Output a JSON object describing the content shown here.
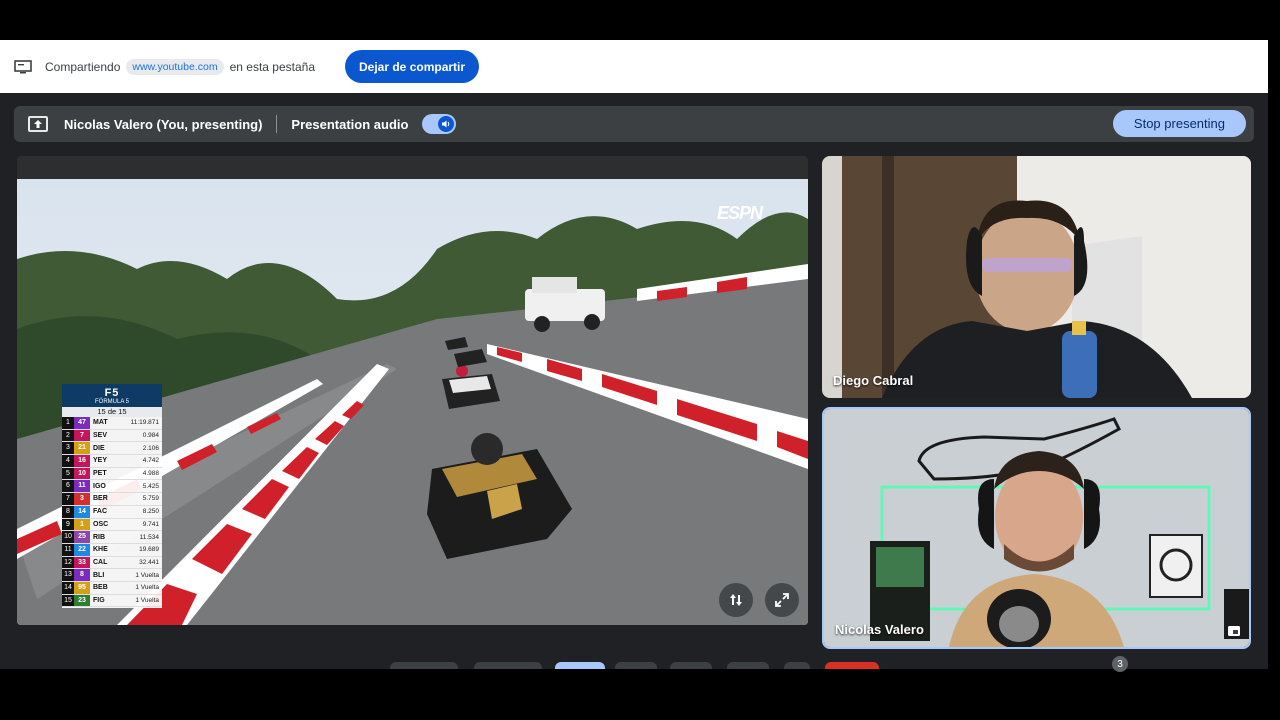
{
  "share_bar": {
    "prefix": "Compartiendo",
    "site": "www.youtube.com",
    "suffix": "en esta pestaña",
    "stop_label": "Dejar de compartir"
  },
  "presenting_bar": {
    "presenter": "Nicolas Valero (You, presenting)",
    "audio_label": "Presentation audio",
    "audio_on": true,
    "stop_label": "Stop presenting"
  },
  "video": {
    "broadcaster": "ESPN",
    "timing_tower": {
      "series": "FÓRMULA 5",
      "lap": "15 de 15",
      "rows": [
        {
          "pos": "1",
          "num": "47",
          "code": "MAT",
          "time": "11:19.871",
          "color": "#7b2cbf"
        },
        {
          "pos": "2",
          "num": "7",
          "code": "SEV",
          "time": "0.984",
          "color": "#c2185b"
        },
        {
          "pos": "3",
          "num": "21",
          "code": "DIE",
          "time": "2.106",
          "color": "#d4a017"
        },
        {
          "pos": "4",
          "num": "16",
          "code": "YEY",
          "time": "4.742",
          "color": "#c2185b"
        },
        {
          "pos": "5",
          "num": "10",
          "code": "PET",
          "time": "4.988",
          "color": "#c2185b"
        },
        {
          "pos": "6",
          "num": "11",
          "code": "IGO",
          "time": "5.425",
          "color": "#7b2cbf"
        },
        {
          "pos": "7",
          "num": "3",
          "code": "BER",
          "time": "5.759",
          "color": "#d32f2f"
        },
        {
          "pos": "8",
          "num": "14",
          "code": "FAC",
          "time": "8.250",
          "color": "#1e88e5"
        },
        {
          "pos": "9",
          "num": "1",
          "code": "OSC",
          "time": "9.741",
          "color": "#d4a017"
        },
        {
          "pos": "10",
          "num": "25",
          "code": "RIB",
          "time": "11.534",
          "color": "#8e44ad"
        },
        {
          "pos": "11",
          "num": "22",
          "code": "KHE",
          "time": "19.689",
          "color": "#1e88e5"
        },
        {
          "pos": "12",
          "num": "33",
          "code": "CAL",
          "time": "32.441",
          "color": "#c2185b"
        },
        {
          "pos": "13",
          "num": "8",
          "code": "BLI",
          "time": "1 Vuelta",
          "color": "#7b2cbf"
        },
        {
          "pos": "14",
          "num": "95",
          "code": "BEB",
          "time": "1 Vuelta",
          "color": "#d4a017"
        },
        {
          "pos": "15",
          "num": "23",
          "code": "FIG",
          "time": "1 Vuelta",
          "color": "#2e7d32"
        }
      ]
    }
  },
  "participants": [
    {
      "name": "Diego Cabral"
    },
    {
      "name": "Nicolas Valero"
    }
  ],
  "participant_count": "3",
  "colors": {
    "accent": "#0b57d0",
    "stop_presenting_bg": "#a8c7fa",
    "active_speaker_border": "#a8c7fa"
  }
}
